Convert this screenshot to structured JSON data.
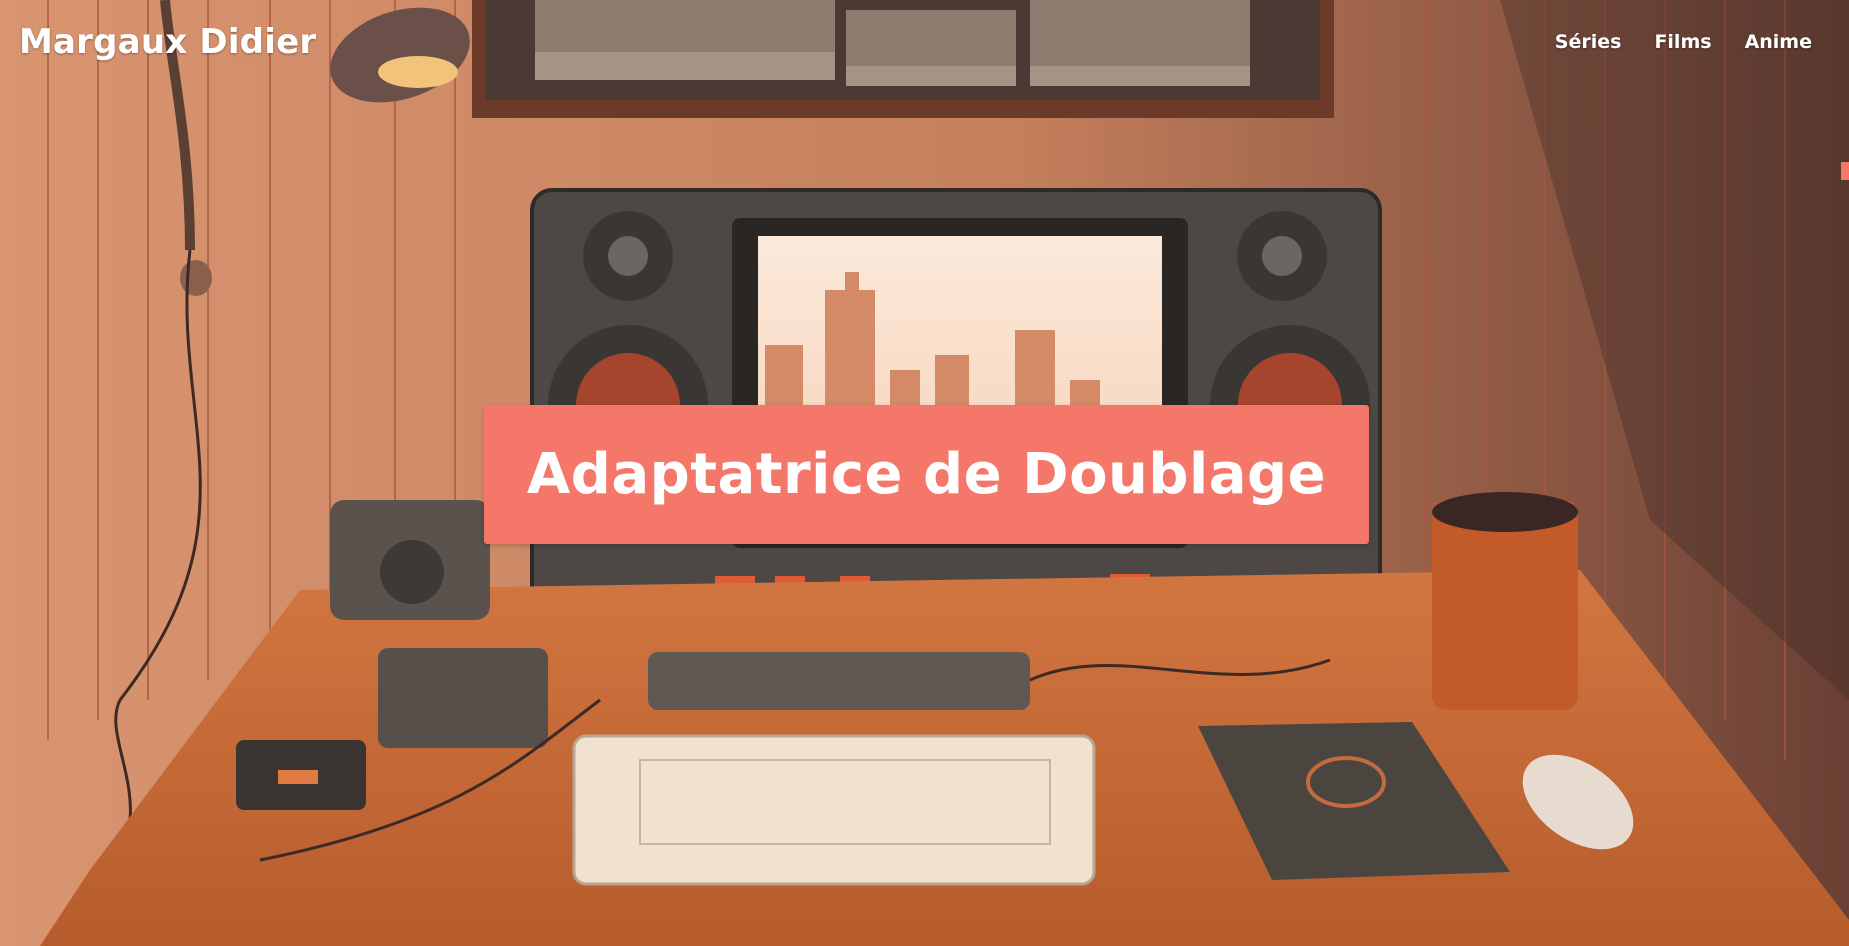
{
  "brand": {
    "name": "Margaux Didier"
  },
  "nav": {
    "items": [
      {
        "label": "Séries"
      },
      {
        "label": "Films"
      },
      {
        "label": "Anime"
      }
    ]
  },
  "hero": {
    "headline": "Adaptatrice de Doublage",
    "background_image": "illustrated dubbing studio desk with retro monitor, speakers, keyboard, mixer, lamp, mug and mouse"
  },
  "colors": {
    "accent": "#f4776a",
    "text": "#ffffff",
    "wall": "#c98461",
    "desk": "#c86a35",
    "equipment": "#4a4440"
  }
}
